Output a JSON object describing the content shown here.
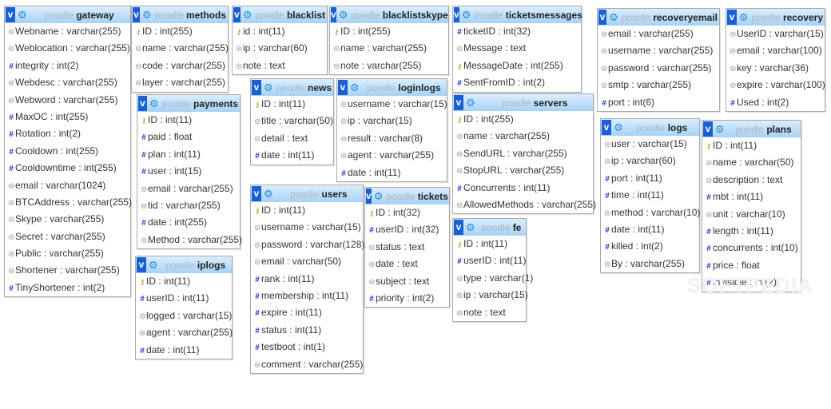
{
  "database": "poodle",
  "collapse_label": "v",
  "watermark": "SOFTPEDIA",
  "tables": [
    {
      "name": "gateway",
      "fields": [
        [
          "txt",
          "Webname : varchar(255)"
        ],
        [
          "txt",
          "Weblocation : varchar(255)"
        ],
        [
          "num",
          "integrity : int(2)"
        ],
        [
          "txt",
          "Webdesc : varchar(255)"
        ],
        [
          "txt",
          "Webword : varchar(255)"
        ],
        [
          "num",
          "MaxOC : int(255)"
        ],
        [
          "num",
          "Rotation : int(2)"
        ],
        [
          "num",
          "Cooldown : int(255)"
        ],
        [
          "num",
          "Cooldowntime : int(255)"
        ],
        [
          "txt",
          "email : varchar(1024)"
        ],
        [
          "txt",
          "BTCAddress : varchar(255)"
        ],
        [
          "txt",
          "Skype : varchar(255)"
        ],
        [
          "txt",
          "Secret : varchar(255)"
        ],
        [
          "txt",
          "Public : varchar(255)"
        ],
        [
          "txt",
          "Shortener : varchar(255)"
        ],
        [
          "num",
          "TinyShortener : int(2)"
        ]
      ]
    },
    {
      "name": "methods",
      "fields": [
        [
          "key",
          "ID : int(255)"
        ],
        [
          "txt",
          "name : varchar(255)"
        ],
        [
          "txt",
          "code : varchar(255)"
        ],
        [
          "txt",
          "layer : varchar(255)"
        ]
      ]
    },
    {
      "name": "blacklist",
      "fields": [
        [
          "key",
          "id : int(11)"
        ],
        [
          "txt",
          "ip : varchar(60)"
        ],
        [
          "txt",
          "note : text"
        ]
      ]
    },
    {
      "name": "blacklistskype",
      "fields": [
        [
          "key",
          "ID : int(255)"
        ],
        [
          "txt",
          "name : varchar(255)"
        ],
        [
          "txt",
          "note : varchar(255)"
        ]
      ]
    },
    {
      "name": "ticketsmessages",
      "fields": [
        [
          "num",
          "ticketID : int(32)"
        ],
        [
          "txt",
          "Message : text"
        ],
        [
          "key",
          "MessageDate : int(255)"
        ],
        [
          "num",
          "SentFromID : int(2)"
        ]
      ]
    },
    {
      "name": "recoveryemail",
      "fields": [
        [
          "txt",
          "email : varchar(255)"
        ],
        [
          "txt",
          "username : varchar(255)"
        ],
        [
          "txt",
          "password : varchar(255)"
        ],
        [
          "txt",
          "smtp : varchar(255)"
        ],
        [
          "num",
          "port : int(6)"
        ]
      ]
    },
    {
      "name": "recovery",
      "fields": [
        [
          "txt",
          "UserID : varchar(15)"
        ],
        [
          "txt",
          "email : varchar(100)"
        ],
        [
          "txt",
          "key : varchar(36)"
        ],
        [
          "txt",
          "expire : varchar(100)"
        ],
        [
          "num",
          "Used : int(2)"
        ]
      ]
    },
    {
      "name": "payments",
      "fields": [
        [
          "key",
          "ID : int(11)"
        ],
        [
          "num",
          "paid : float"
        ],
        [
          "num",
          "plan : int(11)"
        ],
        [
          "num",
          "user : int(15)"
        ],
        [
          "txt",
          "email : varchar(255)"
        ],
        [
          "txt",
          "tid : varchar(255)"
        ],
        [
          "num",
          "date : int(255)"
        ],
        [
          "txt",
          "Method : varchar(255)"
        ]
      ]
    },
    {
      "name": "news",
      "fields": [
        [
          "key",
          "ID : int(11)"
        ],
        [
          "txt",
          "title : varchar(50)"
        ],
        [
          "txt",
          "detail : text"
        ],
        [
          "num",
          "date : int(11)"
        ]
      ]
    },
    {
      "name": "loginlogs",
      "fields": [
        [
          "txt",
          "username : varchar(15)"
        ],
        [
          "txt",
          "ip : varchar(15)"
        ],
        [
          "txt",
          "result : varchar(8)"
        ],
        [
          "txt",
          "agent : varchar(255)"
        ],
        [
          "num",
          "date : int(11)"
        ]
      ]
    },
    {
      "name": "servers",
      "fields": [
        [
          "key",
          "ID : int(255)"
        ],
        [
          "txt",
          "name : varchar(255)"
        ],
        [
          "txt",
          "SendURL : varchar(255)"
        ],
        [
          "txt",
          "StopURL : varchar(255)"
        ],
        [
          "num",
          "Concurrents : int(11)"
        ],
        [
          "txt",
          "AllowedMethods : varchar(255)"
        ]
      ]
    },
    {
      "name": "logs",
      "fields": [
        [
          "txt",
          "user : varchar(15)"
        ],
        [
          "txt",
          "ip : varchar(60)"
        ],
        [
          "num",
          "port : int(11)"
        ],
        [
          "num",
          "time : int(11)"
        ],
        [
          "txt",
          "method : varchar(10)"
        ],
        [
          "num",
          "date : int(11)"
        ],
        [
          "num",
          "killed : int(2)"
        ],
        [
          "txt",
          "By : varchar(255)"
        ]
      ]
    },
    {
      "name": "plans",
      "fields": [
        [
          "key",
          "ID : int(11)"
        ],
        [
          "txt",
          "name : varchar(50)"
        ],
        [
          "txt",
          "description : text"
        ],
        [
          "num",
          "mbt : int(11)"
        ],
        [
          "txt",
          "unit : varchar(10)"
        ],
        [
          "num",
          "length : int(11)"
        ],
        [
          "num",
          "concurrents : int(10)"
        ],
        [
          "num",
          "price : float"
        ],
        [
          "num",
          "invisible : int(2)"
        ]
      ]
    },
    {
      "name": "iplogs",
      "fields": [
        [
          "key",
          "ID : int(11)"
        ],
        [
          "num",
          "userID : int(11)"
        ],
        [
          "txt",
          "logged : varchar(15)"
        ],
        [
          "txt",
          "agent : varchar(255)"
        ],
        [
          "num",
          "date : int(11)"
        ]
      ]
    },
    {
      "name": "users",
      "fields": [
        [
          "key",
          "ID : int(11)"
        ],
        [
          "txt",
          "username : varchar(15)"
        ],
        [
          "txt",
          "password : varchar(128)"
        ],
        [
          "txt",
          "email : varchar(50)"
        ],
        [
          "num",
          "rank : int(11)"
        ],
        [
          "num",
          "membership : int(11)"
        ],
        [
          "num",
          "expire : int(11)"
        ],
        [
          "num",
          "status : int(11)"
        ],
        [
          "num",
          "testboot : int(1)"
        ],
        [
          "txt",
          "comment : varchar(255)"
        ]
      ]
    },
    {
      "name": "tickets",
      "fields": [
        [
          "key",
          "ID : int(32)"
        ],
        [
          "num",
          "userID : int(32)"
        ],
        [
          "txt",
          "status : text"
        ],
        [
          "txt",
          "date : text"
        ],
        [
          "txt",
          "subject : text"
        ],
        [
          "num",
          "priority : int(2)"
        ]
      ]
    },
    {
      "name": "fe",
      "fields": [
        [
          "key",
          "ID : int(11)"
        ],
        [
          "num",
          "userID : int(11)"
        ],
        [
          "txt",
          "type : varchar(1)"
        ],
        [
          "txt",
          "ip : varchar(15)"
        ],
        [
          "txt",
          "note : text"
        ]
      ]
    }
  ]
}
